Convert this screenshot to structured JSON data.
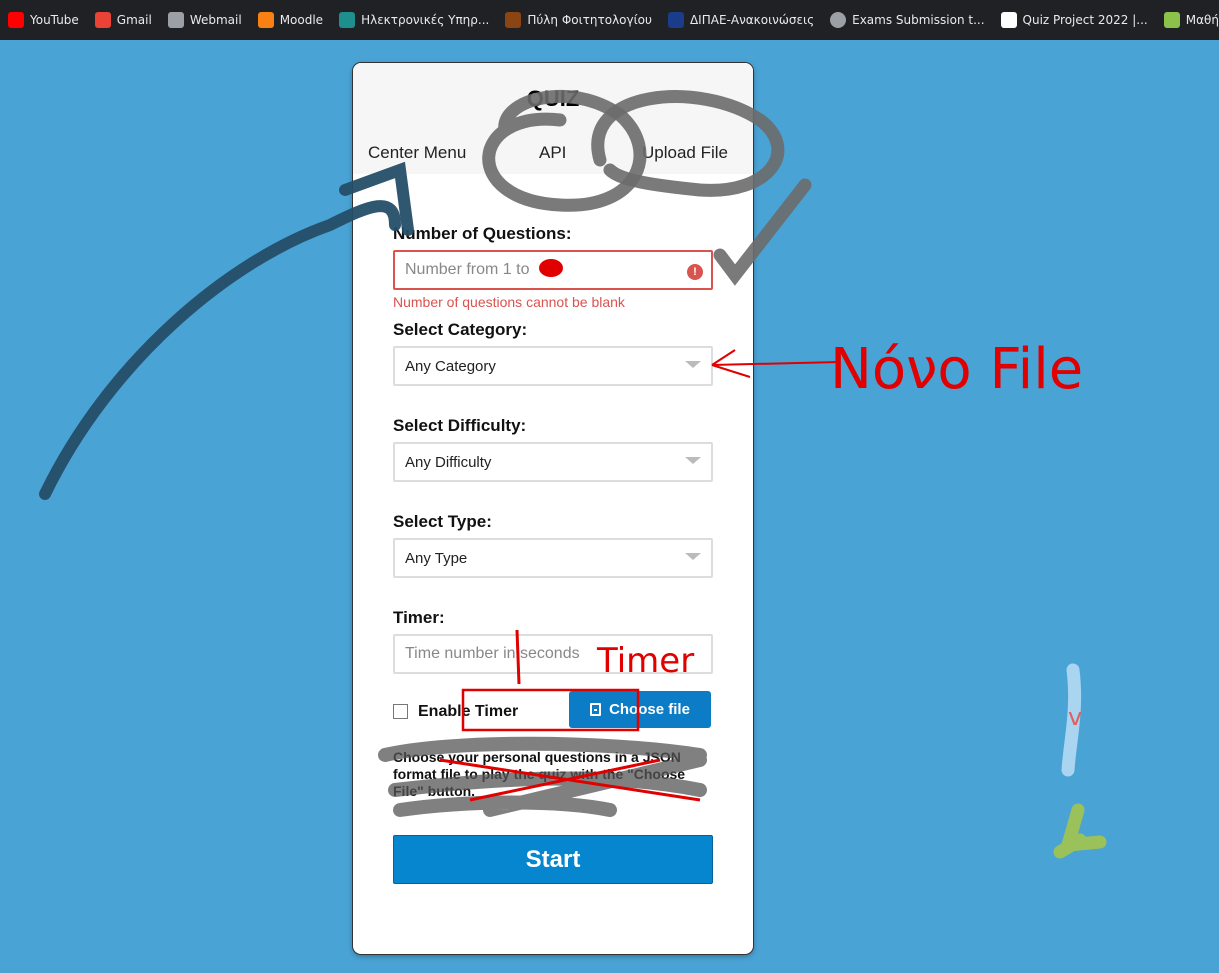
{
  "bookmarks": [
    {
      "label": "YouTube",
      "color": "#ff0000"
    },
    {
      "label": "Gmail",
      "color": "#ea4335"
    },
    {
      "label": "Webmail",
      "color": "#9aa0a6"
    },
    {
      "label": "Moodle",
      "color": "#f98012"
    },
    {
      "label": "Ηλεκτρονικές Υπηρ...",
      "color": "#1e8e8e"
    },
    {
      "label": "Πύλη Φοιτητολογίου",
      "color": "#8b4513"
    },
    {
      "label": "ΔΙΠΑΕ-Ανακοινώσεις",
      "color": "#1a3c8b"
    },
    {
      "label": "Exams Submission t...",
      "color": "#9aa0a6"
    },
    {
      "label": "Quiz Project 2022 |...",
      "color": "#ffffff"
    },
    {
      "label": "Μαθήματα ΚΕΚ",
      "color": "#8bc34a"
    }
  ],
  "quiz": {
    "title": "QUIZ",
    "tabs": {
      "center": "Center Menu",
      "api": "API",
      "upload": "Upload File"
    },
    "num_questions": {
      "label": "Number of Questions:",
      "placeholder": "Number from 1 to",
      "error": "Number of questions cannot be blank"
    },
    "category": {
      "label": "Select Category:",
      "value": "Any Category"
    },
    "difficulty": {
      "label": "Select Difficulty:",
      "value": "Any Difficulty"
    },
    "type": {
      "label": "Select Type:",
      "value": "Any Type"
    },
    "timer": {
      "label": "Timer:",
      "placeholder": "Time number in seconds"
    },
    "enable_timer": "Enable Timer",
    "choose_file": "Choose file",
    "help": "Choose your personal questions in a JSON format file to play the quiz with the \"Choose File\" button.",
    "start": "Start"
  },
  "annotations": {
    "new_file": "Νόνο File",
    "timer": "Timer",
    "v": "v"
  },
  "colors": {
    "accent": "#0586cf",
    "background": "#4aa3d5",
    "error": "#d9534f",
    "annotation_red": "#e00000"
  }
}
